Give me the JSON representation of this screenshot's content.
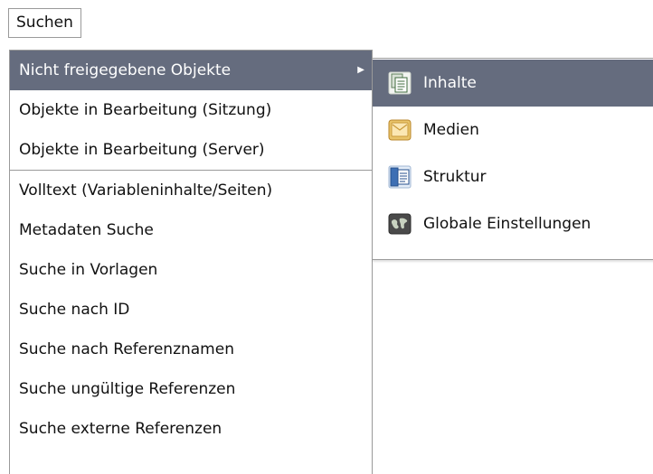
{
  "menubar": {
    "search_label": "Suchen"
  },
  "search_menu": {
    "items": [
      {
        "label": "Nicht freigegebene Objekte"
      },
      {
        "label": "Objekte in Bearbeitung (Sitzung)"
      },
      {
        "label": "Objekte in Bearbeitung (Server)"
      },
      {
        "label": "Volltext (Variableninhalte/Seiten)"
      },
      {
        "label": "Metadaten Suche"
      },
      {
        "label": "Suche in Vorlagen"
      },
      {
        "label": "Suche nach ID"
      },
      {
        "label": "Suche nach Referenznamen"
      },
      {
        "label": "Suche ungültige Referenzen"
      },
      {
        "label": "Suche externe Referenzen"
      }
    ]
  },
  "submenu": {
    "items": [
      {
        "label": "Inhalte",
        "icon": "content-store-icon"
      },
      {
        "label": "Medien",
        "icon": "media-store-icon"
      },
      {
        "label": "Struktur",
        "icon": "structure-store-icon"
      },
      {
        "label": "Globale Einstellungen",
        "icon": "global-settings-icon"
      }
    ]
  },
  "colors": {
    "selection": "#656c7e",
    "border": "#9a9a9a"
  }
}
